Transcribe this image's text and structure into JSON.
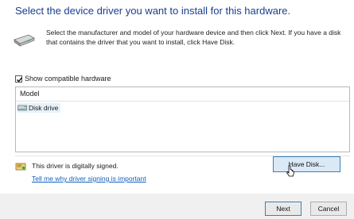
{
  "header": {
    "title": "Select the device driver you want to install for this hardware."
  },
  "intro": {
    "icon": "hardware-drive-icon",
    "text": "Select the manufacturer and model of your hardware device and then click Next. If you have a disk that contains the driver that you want to install, click Have Disk."
  },
  "compat": {
    "label": "Show compatible hardware",
    "checked": true
  },
  "model_list": {
    "header": "Model",
    "items": [
      {
        "icon": "disk-drive-icon",
        "label": "Disk drive",
        "selected": true
      }
    ]
  },
  "signing": {
    "icon": "signed-driver-icon",
    "status": "This driver is digitally signed.",
    "link": "Tell me why driver signing is important"
  },
  "buttons": {
    "have_disk": "Have Disk...",
    "next": "Next",
    "cancel": "Cancel"
  },
  "colors": {
    "title": "#1b3d8f",
    "link": "#1060c0",
    "selected_row": "#e5f1fb",
    "focus_border": "#3c7fb1"
  }
}
